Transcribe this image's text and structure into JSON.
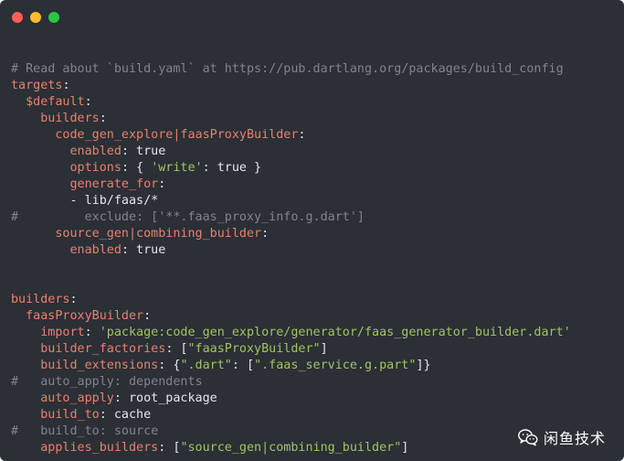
{
  "window": {
    "controls": [
      {
        "name": "close",
        "color": "#fd5f57"
      },
      {
        "name": "minimize",
        "color": "#febc2e"
      },
      {
        "name": "maximize",
        "color": "#29c840"
      }
    ]
  },
  "colors": {
    "background": "#2b2f36",
    "key": "#e9806c",
    "comment": "#7f848e",
    "string": "#a5c261",
    "plain": "#e6e6e6"
  },
  "code_lines": [
    {
      "parts": []
    },
    {
      "parts": [
        {
          "t": "# Read about `build.yaml` at https://pub.dartlang.org/packages/build_config",
          "c": "comment"
        }
      ]
    },
    {
      "parts": [
        {
          "t": "targets",
          "c": "key"
        },
        {
          "t": ":",
          "c": "plain"
        }
      ]
    },
    {
      "parts": [
        {
          "t": "  ",
          "c": "plain"
        },
        {
          "t": "$default",
          "c": "key"
        },
        {
          "t": ":",
          "c": "plain"
        }
      ]
    },
    {
      "parts": [
        {
          "t": "    ",
          "c": "plain"
        },
        {
          "t": "builders",
          "c": "key"
        },
        {
          "t": ":",
          "c": "plain"
        }
      ]
    },
    {
      "parts": [
        {
          "t": "      ",
          "c": "plain"
        },
        {
          "t": "code_gen_explore|faasProxyBuilder",
          "c": "key"
        },
        {
          "t": ":",
          "c": "plain"
        }
      ]
    },
    {
      "parts": [
        {
          "t": "        ",
          "c": "plain"
        },
        {
          "t": "enabled",
          "c": "key"
        },
        {
          "t": ": true",
          "c": "plain"
        }
      ]
    },
    {
      "parts": [
        {
          "t": "        ",
          "c": "plain"
        },
        {
          "t": "options",
          "c": "key"
        },
        {
          "t": ": { ",
          "c": "plain"
        },
        {
          "t": "'write'",
          "c": "string"
        },
        {
          "t": ": true }",
          "c": "plain"
        }
      ]
    },
    {
      "parts": [
        {
          "t": "        ",
          "c": "plain"
        },
        {
          "t": "generate_for",
          "c": "key"
        },
        {
          "t": ":",
          "c": "plain"
        }
      ]
    },
    {
      "parts": [
        {
          "t": "        - lib/faas/*",
          "c": "plain"
        }
      ]
    },
    {
      "parts": [
        {
          "t": "#         exclude: ['**.faas_proxy_info.g.dart']",
          "c": "comment"
        }
      ]
    },
    {
      "parts": [
        {
          "t": "      ",
          "c": "plain"
        },
        {
          "t": "source_gen|combining_builder",
          "c": "key"
        },
        {
          "t": ":",
          "c": "plain"
        }
      ]
    },
    {
      "parts": [
        {
          "t": "        ",
          "c": "plain"
        },
        {
          "t": "enabled",
          "c": "key"
        },
        {
          "t": ": true",
          "c": "plain"
        }
      ]
    },
    {
      "parts": []
    },
    {
      "parts": []
    },
    {
      "parts": [
        {
          "t": "builders",
          "c": "key"
        },
        {
          "t": ":",
          "c": "plain"
        }
      ]
    },
    {
      "parts": [
        {
          "t": "  ",
          "c": "plain"
        },
        {
          "t": "faasProxyBuilder",
          "c": "key"
        },
        {
          "t": ":",
          "c": "plain"
        }
      ]
    },
    {
      "parts": [
        {
          "t": "    ",
          "c": "plain"
        },
        {
          "t": "import",
          "c": "key"
        },
        {
          "t": ": ",
          "c": "plain"
        },
        {
          "t": "'package:code_gen_explore/generator/faas_generator_builder.dart'",
          "c": "string"
        }
      ]
    },
    {
      "parts": [
        {
          "t": "    ",
          "c": "plain"
        },
        {
          "t": "builder_factories",
          "c": "key"
        },
        {
          "t": ": [",
          "c": "plain"
        },
        {
          "t": "\"faasProxyBuilder\"",
          "c": "string"
        },
        {
          "t": "]",
          "c": "plain"
        }
      ]
    },
    {
      "parts": [
        {
          "t": "    ",
          "c": "plain"
        },
        {
          "t": "build_extensions",
          "c": "key"
        },
        {
          "t": ": {",
          "c": "plain"
        },
        {
          "t": "\".dart\"",
          "c": "string"
        },
        {
          "t": ": [",
          "c": "plain"
        },
        {
          "t": "\".faas_service.g.part\"",
          "c": "string"
        },
        {
          "t": "]}",
          "c": "plain"
        }
      ]
    },
    {
      "parts": [
        {
          "t": "#   auto_apply: dependents",
          "c": "comment"
        }
      ]
    },
    {
      "parts": [
        {
          "t": "    ",
          "c": "plain"
        },
        {
          "t": "auto_apply",
          "c": "key"
        },
        {
          "t": ": root_package",
          "c": "plain"
        }
      ]
    },
    {
      "parts": [
        {
          "t": "    ",
          "c": "plain"
        },
        {
          "t": "build_to",
          "c": "key"
        },
        {
          "t": ": cache",
          "c": "plain"
        }
      ]
    },
    {
      "parts": [
        {
          "t": "#   build_to: source",
          "c": "comment"
        }
      ]
    },
    {
      "parts": [
        {
          "t": "    ",
          "c": "plain"
        },
        {
          "t": "applies_builders",
          "c": "key"
        },
        {
          "t": ": [",
          "c": "plain"
        },
        {
          "t": "\"source_gen|combining_builder\"",
          "c": "string"
        },
        {
          "t": "]",
          "c": "plain"
        }
      ]
    }
  ],
  "watermark": {
    "icon": "wechat-icon",
    "text": "闲鱼技术"
  }
}
